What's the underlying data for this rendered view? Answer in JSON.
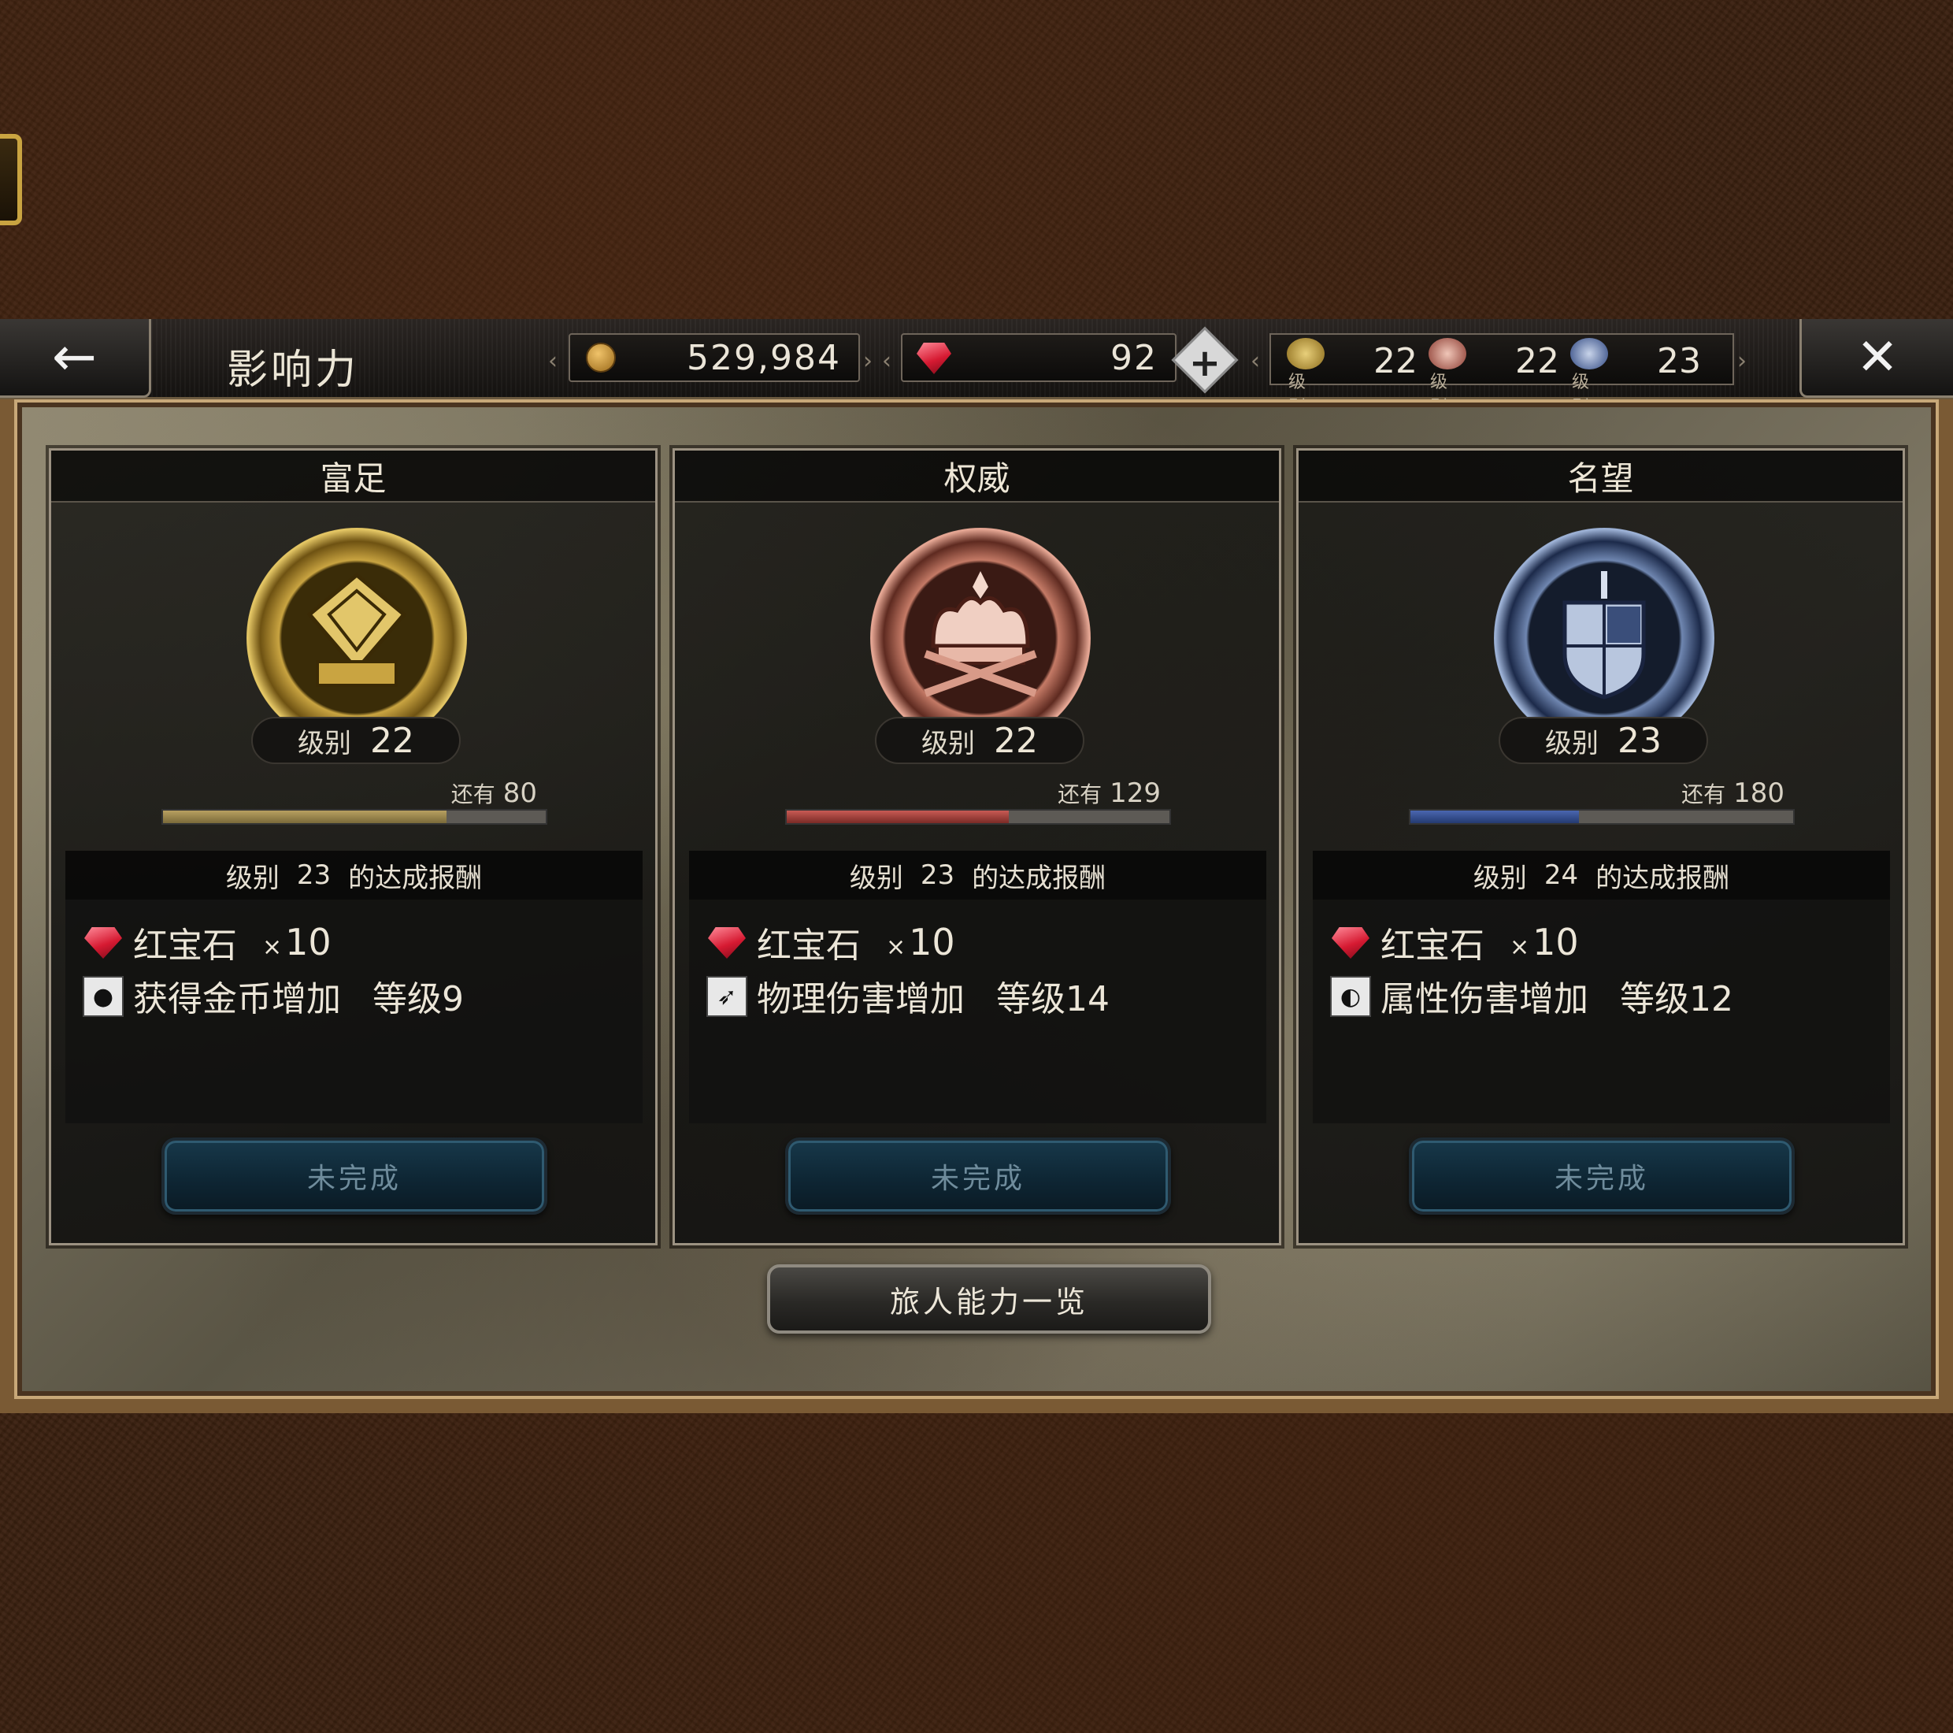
{
  "header": {
    "title": "影响力",
    "gold": "529,984",
    "gems": "92",
    "plus_label": "+",
    "levels": [
      {
        "emblem": "wealth-mini-emblem",
        "label": "级别",
        "value": "22",
        "color": "#c9a441"
      },
      {
        "emblem": "authority-mini-emblem",
        "label": "级别",
        "value": "22",
        "color": "#b86b5a"
      },
      {
        "emblem": "fame-mini-emblem",
        "label": "级别",
        "value": "23",
        "color": "#6f86b0"
      }
    ]
  },
  "nav": {
    "back_label": "←",
    "close_label": "✕"
  },
  "cards": [
    {
      "name": "富足",
      "level_label": "级别",
      "level": "22",
      "remain_label": "还有",
      "remain_value": "80",
      "progress": 0.74,
      "color": "#a08a4a",
      "reward_level_label": "级别",
      "reward_level": "23",
      "reward_title_suffix": "的达成报酬",
      "rewards": [
        {
          "icon": "ruby-icon",
          "name": "红宝石",
          "qty_prefix": "×",
          "qty": "10"
        },
        {
          "icon": "gold-coins-icon",
          "name": "获得金币增加",
          "level_text": "等级9"
        }
      ],
      "status_label": "未完成"
    },
    {
      "name": "权威",
      "level_label": "级别",
      "level": "22",
      "remain_label": "还有",
      "remain_value": "129",
      "progress": 0.58,
      "color": "#b04a46",
      "reward_level_label": "级别",
      "reward_level": "23",
      "reward_title_suffix": "的达成报酬",
      "rewards": [
        {
          "icon": "ruby-icon",
          "name": "红宝石",
          "qty_prefix": "×",
          "qty": "10"
        },
        {
          "icon": "physical-damage-icon",
          "name": "物理伤害增加",
          "level_text": "等级14"
        }
      ],
      "status_label": "未完成"
    },
    {
      "name": "名望",
      "level_label": "级别",
      "level": "23",
      "remain_label": "还有",
      "remain_value": "180",
      "progress": 0.44,
      "color": "#3f5a9a",
      "reward_level_label": "级别",
      "reward_level": "24",
      "reward_title_suffix": "的达成报酬",
      "rewards": [
        {
          "icon": "ruby-icon",
          "name": "红宝石",
          "qty_prefix": "×",
          "qty": "10"
        },
        {
          "icon": "elemental-damage-icon",
          "name": "属性伤害增加",
          "level_text": "等级12"
        }
      ],
      "status_label": "未完成"
    }
  ],
  "footer": {
    "overview_label": "旅人能力一览"
  }
}
